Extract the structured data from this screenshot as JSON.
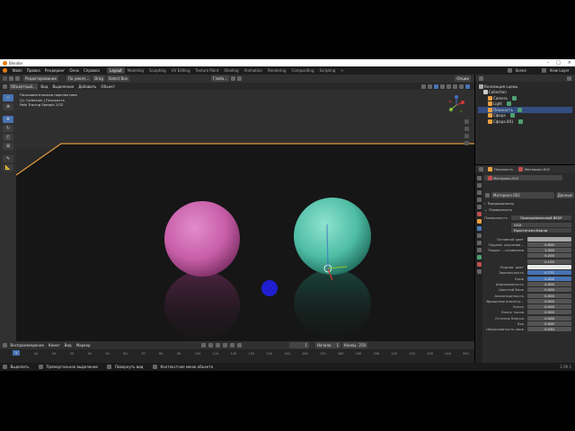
{
  "window": {
    "title": "Blender",
    "controls": [
      "–",
      "□",
      "×"
    ]
  },
  "menubar": {
    "items": [
      "Файл",
      "Правка",
      "Рендеринг",
      "Окно",
      "Справка"
    ],
    "workspaces": [
      "Layout",
      "Modeling",
      "Sculpting",
      "UV Editing",
      "Texture Paint",
      "Shading",
      "Animation",
      "Rendering",
      "Compositing",
      "Scripting"
    ],
    "active_workspace": "Layout",
    "scene": "Scene",
    "view_layer": "View Layer"
  },
  "header": {
    "mode": "Редактирование",
    "orientation": "По умолч...",
    "drag": "Drag",
    "select_box": "Select Box",
    "global": "Глоба...",
    "options": "Опции"
  },
  "viewport_header": {
    "mode": "Объектный...",
    "view": "Вид",
    "select": "Выделение",
    "add": "Добавить",
    "object": "Объект"
  },
  "viewport": {
    "info_line1": "Пользовательская перспектива",
    "info_line2": "(1) Collection | Плоскость",
    "info_line3": "Path Tracing Sample 2/32",
    "colors": {
      "pink": "#c85ea8",
      "teal": "#4fbda5",
      "cursor": "#1f1fd0",
      "edge": "#e09a3c"
    }
  },
  "outliner": {
    "title": "Коллекция сцены",
    "items": [
      {
        "label": "Collection",
        "level": 1
      },
      {
        "label": "Camera",
        "level": 2
      },
      {
        "label": "Light",
        "level": 2
      },
      {
        "label": "Плоскость",
        "level": 2,
        "selected": true
      },
      {
        "label": "Сфера",
        "level": 2
      },
      {
        "label": "Сфера.001",
        "level": 2
      }
    ]
  },
  "properties": {
    "object_name": "Плоскость",
    "material_name": "Материал.002",
    "slot_name": "Материал.002",
    "data_label": "Данные",
    "preview": "Предпросмотр",
    "surface_section": "Поверхность",
    "surface_label": "Поверхность",
    "surface_value": "Принципиальный BSDF",
    "ggx": "GGX",
    "subsurface_method": "Кристенсен-Берли",
    "rows": [
      {
        "label": "Основной цвет",
        "value": ""
      },
      {
        "label": "Подпов. рассеива...",
        "value": "0.000"
      },
      {
        "label": "Радиус ...ссеивания",
        "value": "1.000"
      },
      {
        "label": "",
        "value": "0.200"
      },
      {
        "label": "",
        "value": "0.100"
      },
      {
        "label": "Подпов. цвет",
        "value": ""
      },
      {
        "label": "Зеркальность",
        "value": "0.771",
        "blue": true
      },
      {
        "label": "Блик",
        "value": "0.000",
        "blue": true
      },
      {
        "label": "Шероховатость",
        "value": "0.000"
      },
      {
        "label": "Цветной блик",
        "value": "0.000"
      },
      {
        "label": "Анизотропность",
        "value": "0.000"
      },
      {
        "label": "Вращение анизотр...",
        "value": "0.000"
      },
      {
        "label": "Блеск",
        "value": "0.000"
      },
      {
        "label": "Блеск тысов",
        "value": "0.500"
      },
      {
        "label": "Оттенок блеска",
        "value": "0.000"
      },
      {
        "label": "Лак",
        "value": "0.000"
      },
      {
        "label": "Шероховатость лака",
        "value": "0.030"
      }
    ]
  },
  "timeline": {
    "playback": "Воспроизведение",
    "keying": "Кеинг",
    "view": "Вид",
    "marker": "Маркер",
    "current_frame": "1",
    "start_label": "Начало",
    "start_value": "1",
    "end_label": "Конец",
    "end_value": "250",
    "ticks": [
      "0",
      "10",
      "20",
      "30",
      "40",
      "50",
      "60",
      "70",
      "80",
      "90",
      "100",
      "110",
      "120",
      "130",
      "140",
      "150",
      "160",
      "170",
      "180",
      "190",
      "200",
      "210",
      "220",
      "230",
      "240",
      "250"
    ]
  },
  "statusbar": {
    "select": "Выделить",
    "box_select": "Прямоугольное выделение",
    "rotate_view": "Повернуть вид",
    "context_menu": "Контекстное меню объекта",
    "version": "2.90.1"
  }
}
